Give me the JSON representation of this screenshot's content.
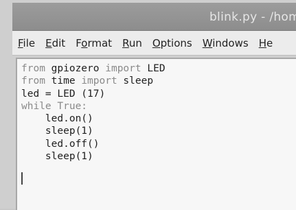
{
  "window": {
    "title": "blink.py - /hom"
  },
  "menu": {
    "items": [
      {
        "key": "file",
        "mnemonic": "F",
        "rest": "ile"
      },
      {
        "key": "edit",
        "mnemonic": "E",
        "rest": "dit"
      },
      {
        "key": "format",
        "pre": "F",
        "mnemonic": "o",
        "rest": "rmat"
      },
      {
        "key": "run",
        "mnemonic": "R",
        "rest": "un"
      },
      {
        "key": "options",
        "mnemonic": "O",
        "rest": "ptions"
      },
      {
        "key": "windows",
        "mnemonic": "W",
        "rest": "indows"
      },
      {
        "key": "help",
        "mnemonic": "H",
        "rest": "e"
      }
    ]
  },
  "editor": {
    "lines": [
      [
        {
          "t": "from",
          "k": true
        },
        {
          "t": " gpiozero "
        },
        {
          "t": "import",
          "k": true
        },
        {
          "t": " LED"
        }
      ],
      [
        {
          "t": "from",
          "k": true
        },
        {
          "t": " time "
        },
        {
          "t": "import",
          "k": true
        },
        {
          "t": " sleep"
        }
      ],
      [
        {
          "t": "led = LED (17)"
        }
      ],
      [
        {
          "t": "while True:",
          "k": true
        }
      ],
      [
        {
          "t": "    led.on()"
        }
      ],
      [
        {
          "t": "    sleep(1)"
        }
      ],
      [
        {
          "t": "    led.off()"
        }
      ],
      [
        {
          "t": "    sleep(1)"
        }
      ]
    ]
  },
  "colors": {
    "keyword": "#8a8a8a",
    "text": "#1e1e1e",
    "editor_bg": "#f7f7f7",
    "titlebar_bg": "#9c9c9c",
    "menubar_bg": "#ececec"
  }
}
